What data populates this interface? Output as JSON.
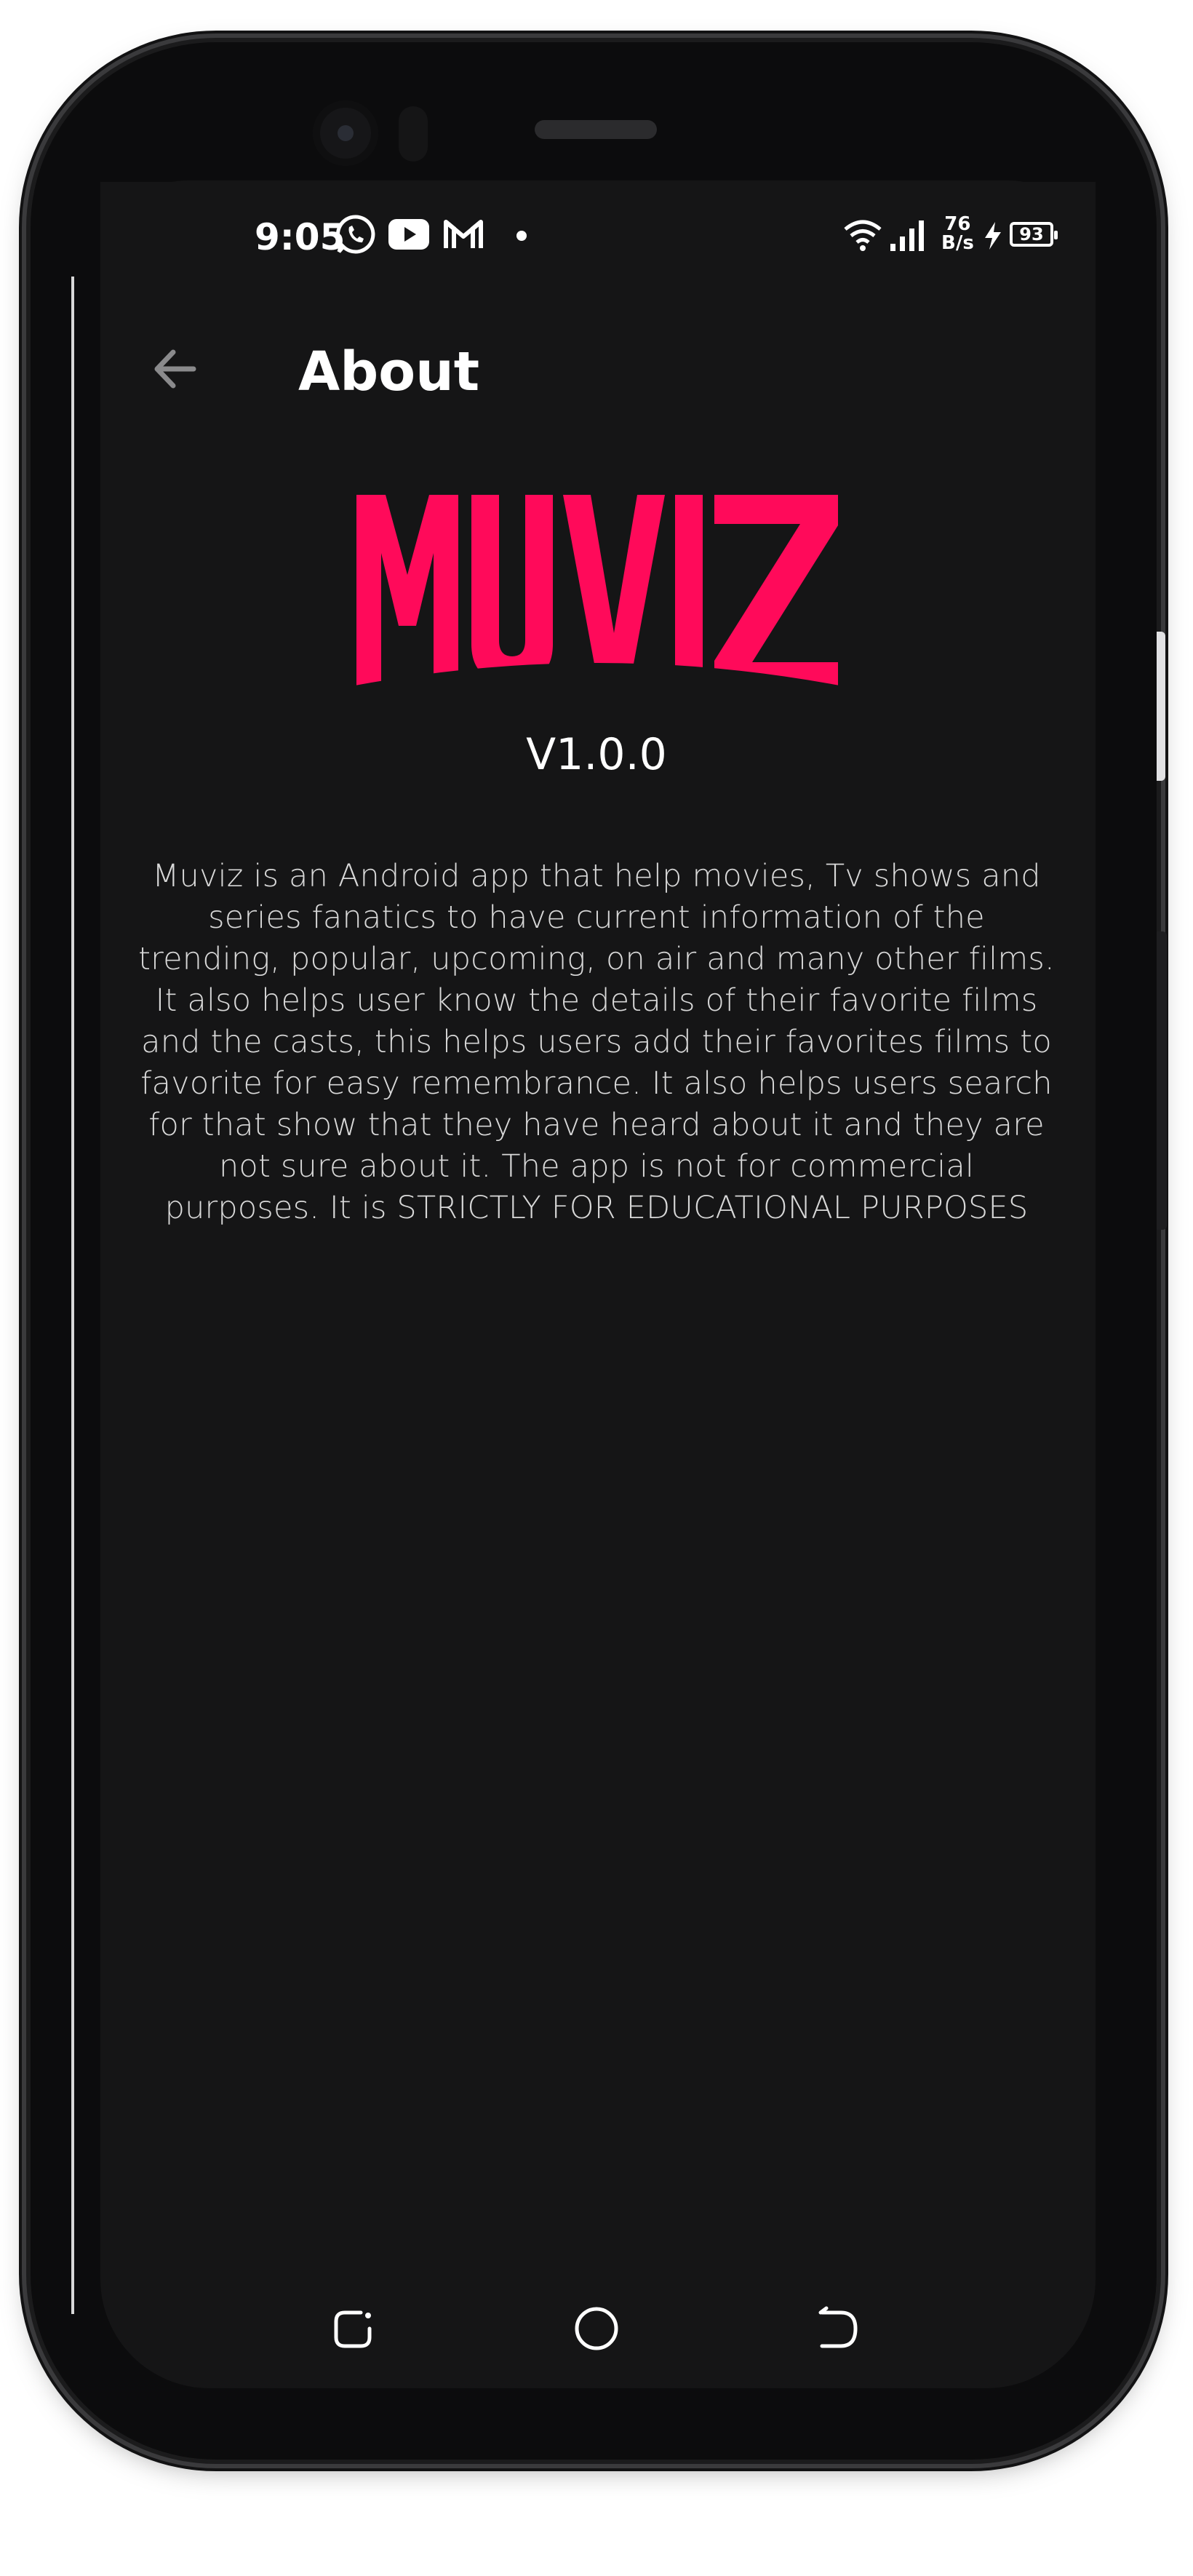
{
  "status_bar": {
    "time": "9:05",
    "net_speed_value": "76",
    "net_speed_unit": "B/s",
    "battery_level": "93",
    "icons": [
      "whatsapp-icon",
      "youtube-icon",
      "gmail-icon",
      "wifi-icon",
      "signal-icon",
      "charging-icon",
      "battery-icon"
    ]
  },
  "app_bar": {
    "title": "About",
    "back_icon": "arrow-left-icon"
  },
  "logo": {
    "text": "MUVIZ",
    "color": "#ff0a5a"
  },
  "version": "V1.0.0",
  "description": "Muviz is an Android app that help movies, Tv shows and series fanatics to have current information of the trending, popular, upcoming, on air and many other films. It also helps user know the details of their favorite films and the casts, this helps users add their favorites films to favorite for easy remembrance. It also helps users search for that show that they have heard about it and they are not sure about it. The app is not for commercial purposes. It is STRICTLY FOR EDUCATIONAL PURPOSES",
  "nav_bar": {
    "buttons": [
      "recents-icon",
      "home-icon",
      "back-icon"
    ]
  },
  "colors": {
    "background": "#151516",
    "accent": "#ff0a5a",
    "text": "#ffffff"
  }
}
